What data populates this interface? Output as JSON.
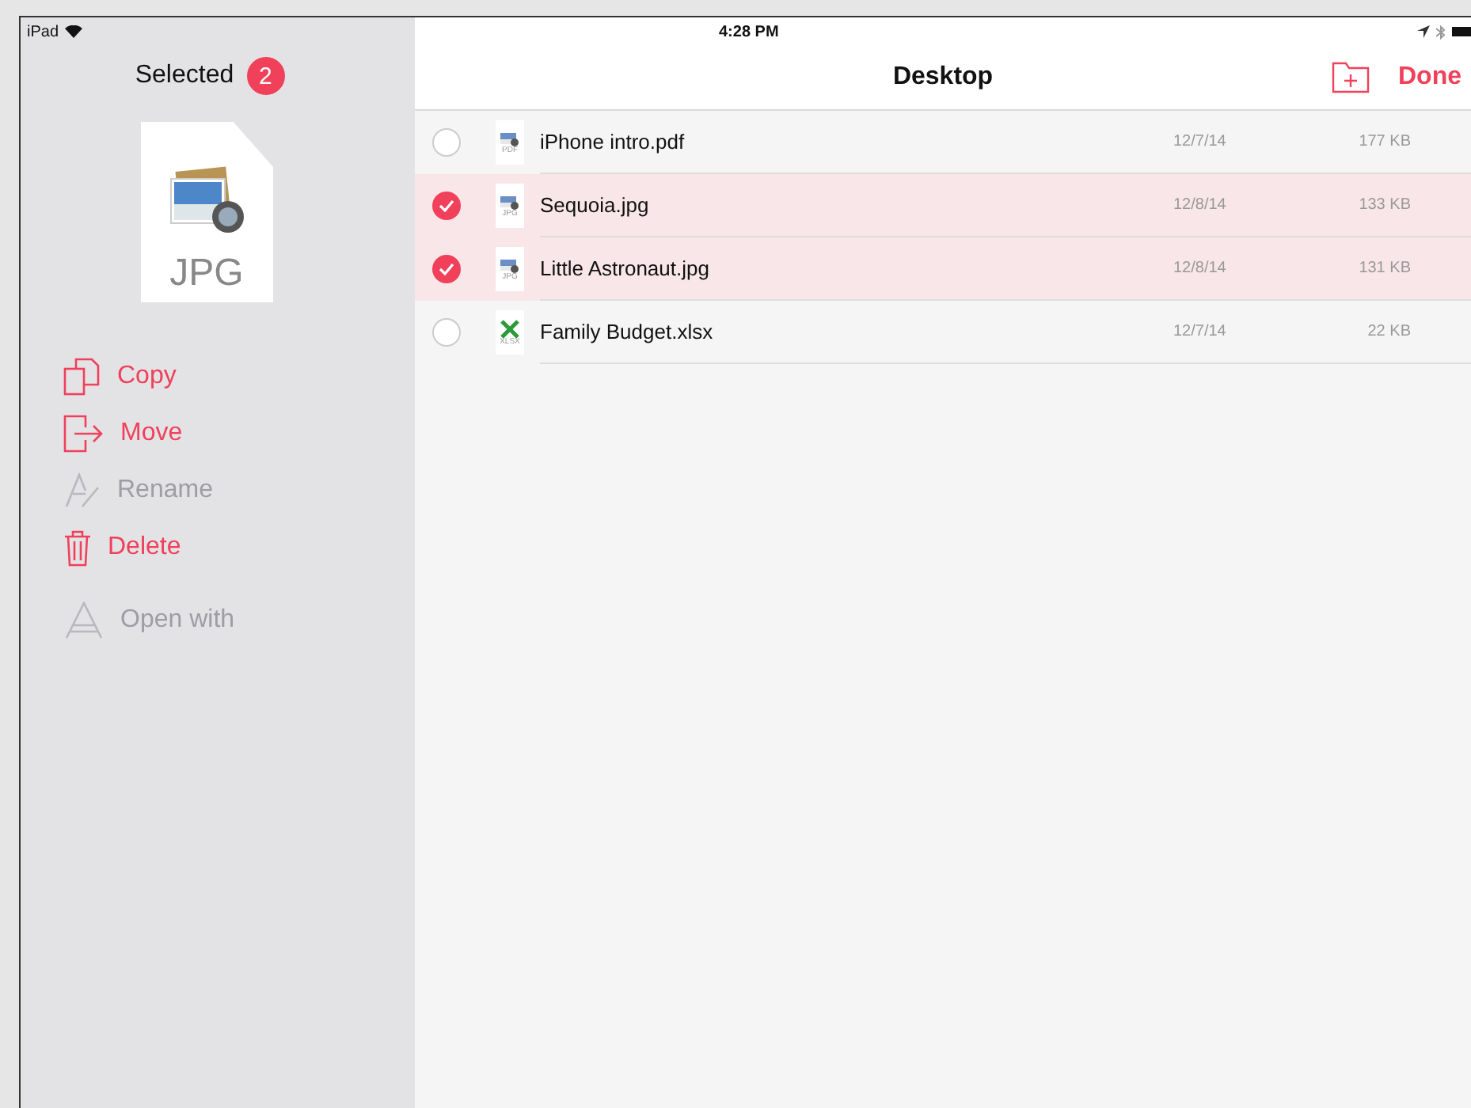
{
  "status_bar": {
    "device": "iPad",
    "time": "4:28 PM"
  },
  "sidebar": {
    "title": "Selected",
    "count": "2",
    "preview_type": "JPG",
    "actions": [
      {
        "kind": "copy",
        "label": "Copy",
        "disabled": false
      },
      {
        "kind": "move",
        "label": "Move",
        "disabled": false
      },
      {
        "kind": "rename",
        "label": "Rename",
        "disabled": true
      },
      {
        "kind": "delete",
        "label": "Delete",
        "disabled": false
      }
    ],
    "secondary_actions": [
      {
        "kind": "open_with",
        "label": "Open with",
        "disabled": true
      }
    ]
  },
  "nav_bar": {
    "title": "Desktop",
    "done": "Done"
  },
  "files": [
    {
      "name": "iPhone intro.pdf",
      "kind": "image",
      "type_label": "PDF",
      "date": "12/7/14",
      "size": "177 KB",
      "selected": false
    },
    {
      "name": "Sequoia.jpg",
      "kind": "image",
      "type_label": "JPG",
      "date": "12/8/14",
      "size": "133 KB",
      "selected": true
    },
    {
      "name": "Little Astronaut.jpg",
      "kind": "image",
      "type_label": "JPG",
      "date": "12/8/14",
      "size": "131 KB",
      "selected": true
    },
    {
      "name": "Family Budget.xlsx",
      "kind": "spreadsheet",
      "type_label": "XLSX",
      "date": "12/7/14",
      "size": "22 KB",
      "selected": false
    }
  ]
}
